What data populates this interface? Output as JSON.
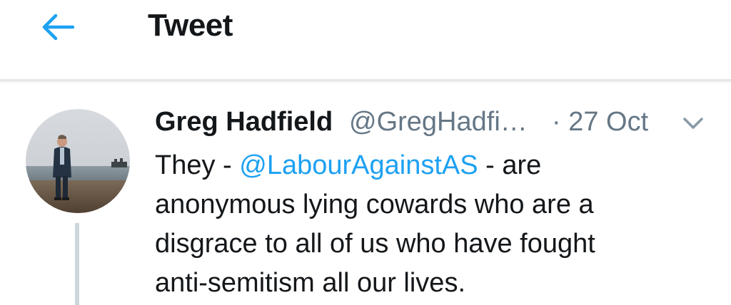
{
  "header": {
    "title": "Tweet",
    "back_icon": "arrow-left-icon",
    "accent_color": "#1da1f2"
  },
  "tweet": {
    "author": {
      "name": "Greg Hadfield",
      "handle": "@GregHadfi…",
      "avatar_icon": "profile-photo"
    },
    "date_prefix": "· 27 Oct",
    "menu_icon": "chevron-down-icon",
    "body": {
      "line1_pre": "They - ",
      "mention": "@LabourAgainstAS",
      "line1_post": " - are",
      "line2": "anonymous lying cowards who are a",
      "line3": "disgrace to all of us who have fought",
      "line4": "anti-semitism all our lives."
    },
    "colors": {
      "text": "#14171a",
      "secondary": "#657786",
      "link": "#1da1f2",
      "thread_line": "#ccd6dd"
    }
  }
}
